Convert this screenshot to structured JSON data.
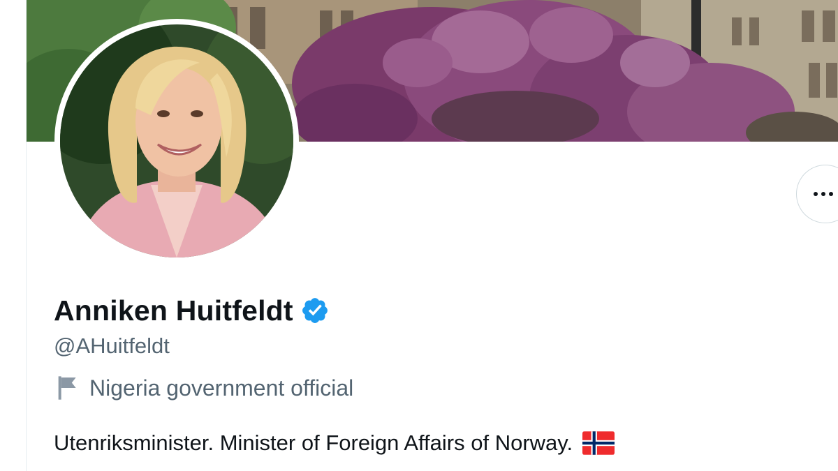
{
  "profile": {
    "display_name": "Anniken Huitfeldt",
    "handle": "@AHuitfeldt",
    "label": "Nigeria government official",
    "bio": "Utenriksminister. Minister of Foreign Affairs of Norway.",
    "verified_icon": "verified-badge-icon",
    "label_icon": "flag-icon",
    "bio_emoji": "norway-flag-icon"
  },
  "colors": {
    "name": "#0f1419",
    "secondary_text": "#536471",
    "verified": "#1d9bf0",
    "border": "#cfd9de"
  },
  "header": {
    "more_button_icon": "more-horizontal-icon"
  }
}
